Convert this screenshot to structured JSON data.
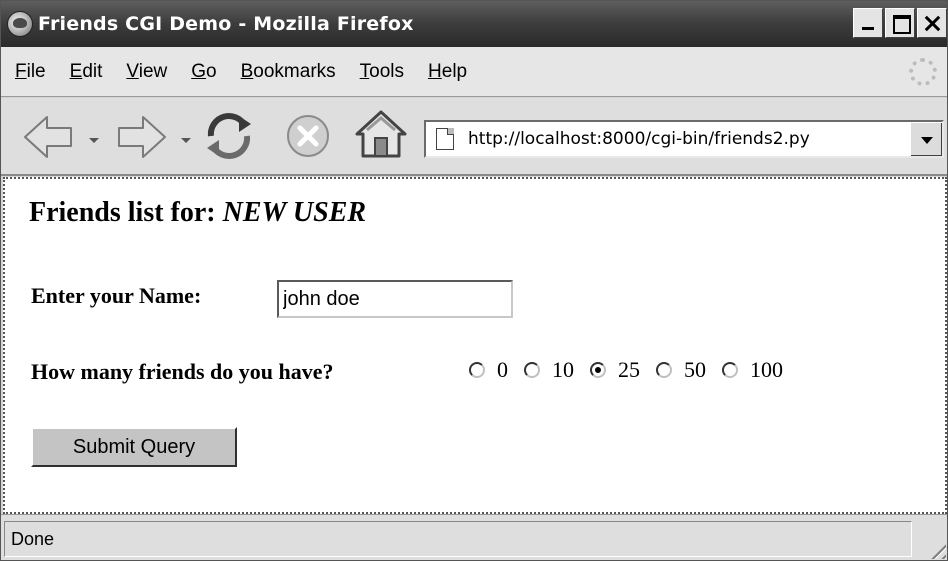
{
  "window": {
    "title": "Friends CGI Demo - Mozilla Firefox"
  },
  "menu": {
    "items": [
      {
        "label": "File",
        "accel": "F",
        "rest": "ile"
      },
      {
        "label": "Edit",
        "accel": "E",
        "rest": "dit"
      },
      {
        "label": "View",
        "accel": "V",
        "rest": "iew"
      },
      {
        "label": "Go",
        "accel": "G",
        "rest": "o"
      },
      {
        "label": "Bookmarks",
        "accel": "B",
        "rest": "ookmarks"
      },
      {
        "label": "Tools",
        "accel": "T",
        "rest": "ools"
      },
      {
        "label": "Help",
        "accel": "H",
        "rest": "elp"
      }
    ]
  },
  "toolbar": {
    "url": "http://localhost:8000/cgi-bin/friends2.py",
    "icons": [
      "back-arrow-icon",
      "forward-arrow-icon",
      "reload-icon",
      "stop-icon",
      "home-icon"
    ]
  },
  "page": {
    "heading_prefix": "Friends list for: ",
    "heading_user": "NEW USER",
    "name_label": "Enter your Name:",
    "name_value": "john doe",
    "friends_label": "How many friends do you have?",
    "radio_options": [
      "0",
      "10",
      "25",
      "50",
      "100"
    ],
    "selected_option": "25",
    "submit_label": "Submit Query"
  },
  "status": {
    "text": "Done"
  }
}
